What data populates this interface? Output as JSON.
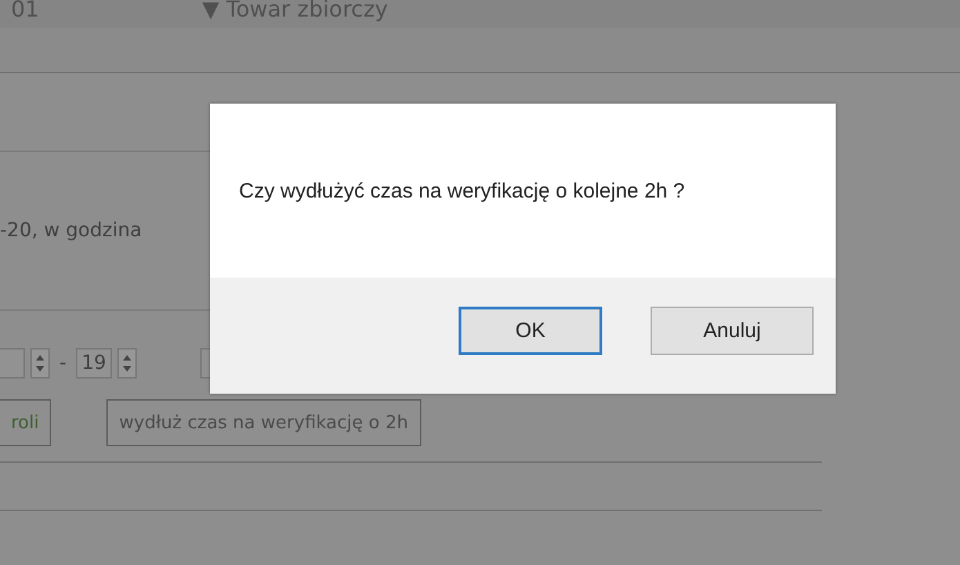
{
  "page": {
    "header": {
      "code": "01",
      "caret": "▼",
      "label": "Towar zbiorczy"
    },
    "note": "-20, w godzina",
    "time_range": {
      "separator": "-",
      "to": "19"
    },
    "buttons": [
      {
        "label": "roli",
        "kind": "green"
      },
      {
        "label": "wydłuż czas na weryfikację o 2h",
        "kind": "plain"
      }
    ]
  },
  "dialog": {
    "message": "Czy wydłużyć czas na weryfikację o kolejne 2h ?",
    "buttons": [
      {
        "label": "OK",
        "selected": true
      },
      {
        "label": "Anuluj",
        "selected": false
      }
    ]
  }
}
